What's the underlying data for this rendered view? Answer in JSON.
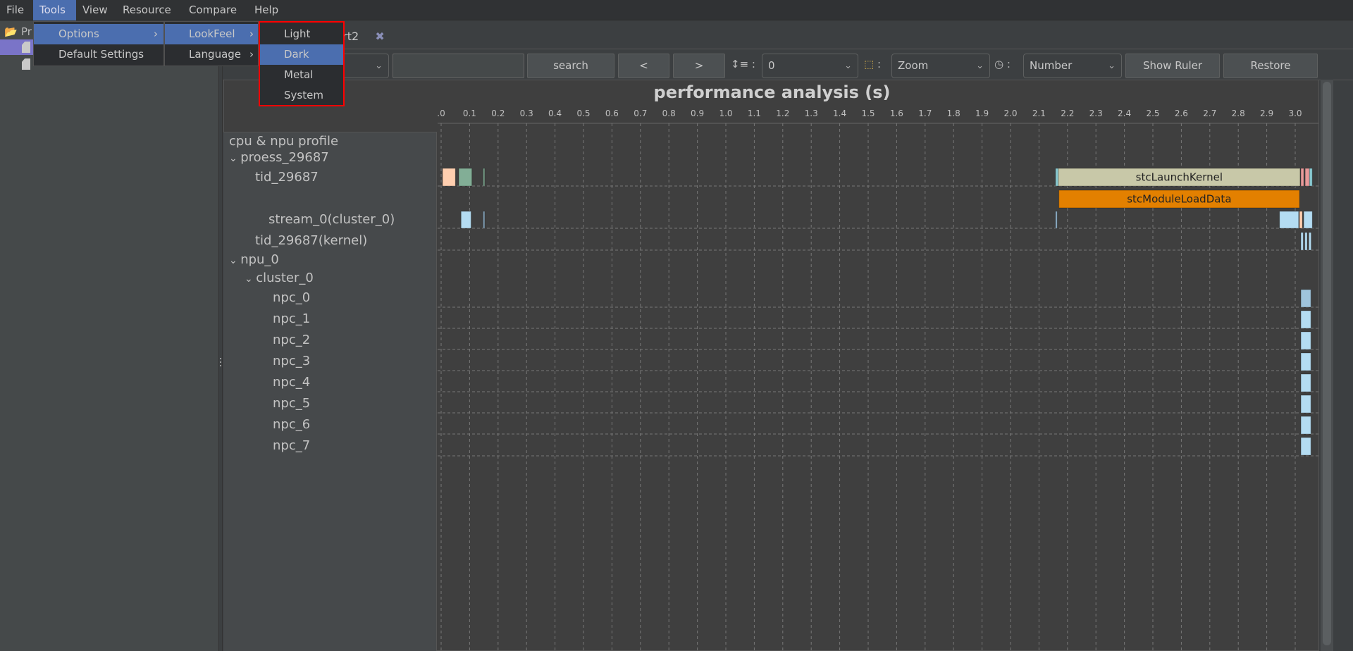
{
  "menubar": {
    "items": [
      "File",
      "Tools",
      "View",
      "Resource",
      "Compare",
      "Help"
    ],
    "active": "Tools"
  },
  "sidebar": {
    "root_label": "Pr"
  },
  "tab": {
    "label": "Report2",
    "close_icon": "close-x-icon"
  },
  "menus": {
    "tools": [
      "Options",
      "Default Settings"
    ],
    "options": [
      "LookFeel",
      "Language"
    ],
    "lookfeel": [
      "Light",
      "Dark",
      "Metal",
      "System"
    ],
    "lookfeel_selected": "Dark",
    "highlight_color": "#4b6eaf",
    "annotation_color": "#ff0000"
  },
  "toolbar": {
    "search_value": "",
    "search_label": "search",
    "prev_label": "<",
    "next_label": ">",
    "depth_value": "0",
    "mode_value": "Zoom",
    "format_value": "Number",
    "ruler_label": "Show Ruler",
    "restore_label": "Restore"
  },
  "tree": {
    "header": "cpu & npu profile",
    "rows": [
      "proess_29687",
      "tid_29687",
      "stream_0(cluster_0)",
      "tid_29687(kernel)",
      "npu_0",
      "cluster_0",
      "npc_0",
      "npc_1",
      "npc_2",
      "npc_3",
      "npc_4",
      "npc_5",
      "npc_6",
      "npc_7"
    ]
  },
  "chart_data": {
    "type": "timeline",
    "title": "performance analysis (s)",
    "tick_labels": [
      ".0",
      "0.1",
      "0.2",
      "0.3",
      "0.4",
      "0.5",
      "0.6",
      "0.7",
      "0.8",
      "0.9",
      "1.0",
      "1.1",
      "1.2",
      "1.3",
      "1.4",
      "1.5",
      "1.6",
      "1.7",
      "1.8",
      "1.9",
      "2.0",
      "2.1",
      "2.2",
      "2.3",
      "2.4",
      "2.5",
      "2.6",
      "2.7",
      "2.8",
      "2.9",
      "3.0"
    ],
    "xlim": [
      0,
      3.08
    ],
    "grid": true,
    "events": [
      {
        "row": "tid_29687",
        "start": 0.005,
        "end": 0.05,
        "color": "#ffcfb0"
      },
      {
        "row": "tid_29687",
        "start": 0.062,
        "end": 0.108,
        "color": "#82ae96"
      },
      {
        "row": "tid_29687",
        "start": 0.148,
        "end": 0.153,
        "color": "#82ae96"
      },
      {
        "row": "tid_29687",
        "start": 2.158,
        "end": 2.168,
        "color": "#88c8d0"
      },
      {
        "row": "tid_29687",
        "start": 2.168,
        "end": 3.017,
        "color": "#c8c8a8",
        "label": "stcLaunchKernel"
      },
      {
        "row": "tid_29687",
        "start": 3.02,
        "end": 3.03,
        "color": "#e89a9a"
      },
      {
        "row": "tid_29687",
        "start": 3.035,
        "end": 3.05,
        "color": "#e89a9a"
      },
      {
        "row": "tid_29687",
        "start": 3.05,
        "end": 3.06,
        "color": "#88c8d0"
      },
      {
        "row": "tid_29687-2",
        "start": 2.17,
        "end": 3.015,
        "color": "#e38000",
        "label": "stcModuleLoadData"
      },
      {
        "row": "stream_0(cluster_0)",
        "start": 0.07,
        "end": 0.105,
        "color": "#b4dcf2"
      },
      {
        "row": "stream_0(cluster_0)",
        "start": 0.148,
        "end": 0.153,
        "color": "#8fb0c8"
      },
      {
        "row": "stream_0(cluster_0)",
        "start": 2.158,
        "end": 2.164,
        "color": "#8fb0c8"
      },
      {
        "row": "stream_0(cluster_0)",
        "start": 2.945,
        "end": 3.012,
        "color": "#b4dcf2"
      },
      {
        "row": "stream_0(cluster_0)",
        "start": 3.015,
        "end": 3.025,
        "color": "#ffcfb0"
      },
      {
        "row": "stream_0(cluster_0)",
        "start": 3.03,
        "end": 3.06,
        "color": "#b4dcf2"
      },
      {
        "row": "tid_29687(kernel)",
        "start": 3.02,
        "end": 3.028,
        "color": "#b4dcf2"
      },
      {
        "row": "tid_29687(kernel)",
        "start": 3.034,
        "end": 3.042,
        "color": "#b4dcf2"
      },
      {
        "row": "tid_29687(kernel)",
        "start": 3.048,
        "end": 3.056,
        "color": "#b4dcf2"
      },
      {
        "row": "npc_0",
        "start": 3.02,
        "end": 3.055,
        "color": "#9fc4dc"
      },
      {
        "row": "npc_1",
        "start": 3.02,
        "end": 3.055,
        "color": "#b4dcf2"
      },
      {
        "row": "npc_2",
        "start": 3.02,
        "end": 3.055,
        "color": "#b4dcf2"
      },
      {
        "row": "npc_3",
        "start": 3.02,
        "end": 3.055,
        "color": "#b4dcf2"
      },
      {
        "row": "npc_4",
        "start": 3.02,
        "end": 3.055,
        "color": "#b4dcf2"
      },
      {
        "row": "npc_5",
        "start": 3.02,
        "end": 3.055,
        "color": "#b4dcf2"
      },
      {
        "row": "npc_6",
        "start": 3.02,
        "end": 3.055,
        "color": "#b4dcf2"
      },
      {
        "row": "npc_7",
        "start": 3.02,
        "end": 3.055,
        "color": "#b4dcf2"
      }
    ]
  }
}
